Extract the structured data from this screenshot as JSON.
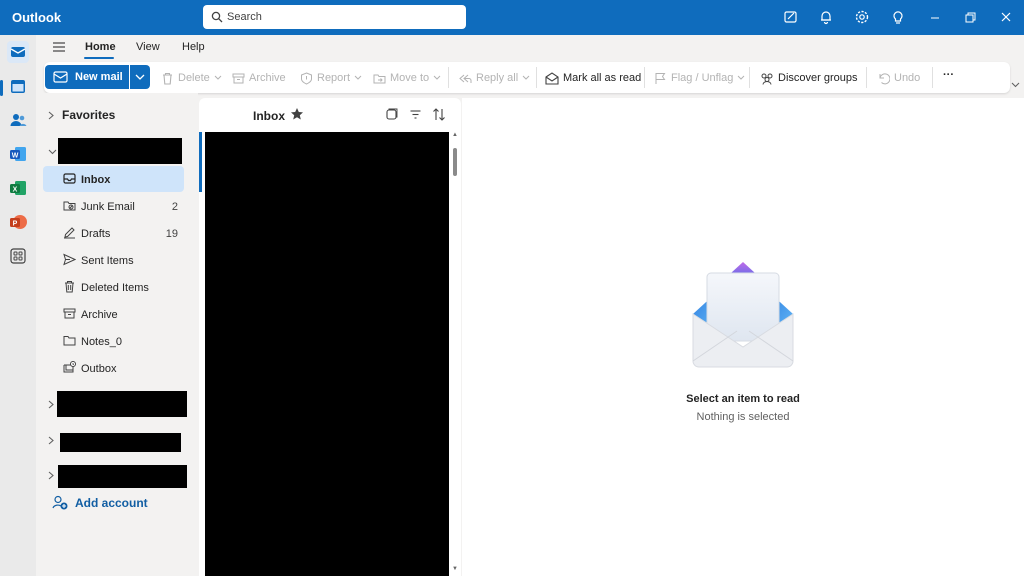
{
  "app": {
    "title": "Outlook"
  },
  "search": {
    "placeholder": "Search"
  },
  "titlebar_icons": [
    "compose-note-icon",
    "bell-icon",
    "gear-icon",
    "lightbulb-icon",
    "minimize-icon",
    "restore-icon",
    "close-icon"
  ],
  "rail": [
    "mail-icon",
    "calendar-icon",
    "people-icon",
    "word-icon",
    "excel-icon",
    "powerpoint-icon",
    "apps-icon"
  ],
  "menu": {
    "tabs": [
      "Home",
      "View",
      "Help"
    ],
    "active": "Home"
  },
  "ribbon": {
    "new_mail": "New mail",
    "delete": "Delete",
    "archive": "Archive",
    "report": "Report",
    "move_to": "Move to",
    "reply_all": "Reply all",
    "mark_all_read": "Mark all as read",
    "flag_unflag": "Flag / Unflag",
    "discover_groups": "Discover groups",
    "undo": "Undo",
    "more": "···"
  },
  "folders": {
    "favorites": "Favorites",
    "items": [
      {
        "name": "Inbox",
        "count": "",
        "icon": "inbox-icon",
        "selected": true
      },
      {
        "name": "Junk Email",
        "count": "2",
        "icon": "junk-icon"
      },
      {
        "name": "Drafts",
        "count": "19",
        "icon": "drafts-icon"
      },
      {
        "name": "Sent Items",
        "count": "",
        "icon": "sent-icon"
      },
      {
        "name": "Deleted Items",
        "count": "",
        "icon": "trash-icon"
      },
      {
        "name": "Archive",
        "count": "",
        "icon": "archive-icon"
      },
      {
        "name": "Notes_0",
        "count": "",
        "icon": "folder-icon"
      },
      {
        "name": "Outbox",
        "count": "",
        "icon": "outbox-icon"
      }
    ],
    "add_account": "Add account"
  },
  "message_list": {
    "title": "Inbox"
  },
  "reading_pane": {
    "title": "Select an item to read",
    "subtitle": "Nothing is selected"
  },
  "colors": {
    "accent": "#0f6cbd",
    "selected": "#cfe4fa"
  }
}
